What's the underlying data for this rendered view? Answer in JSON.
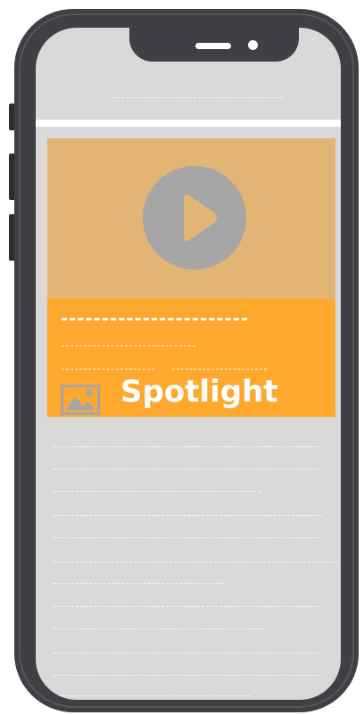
{
  "colors": {
    "phone_body": "#3f3f44",
    "screen_background": "#d9d9d9",
    "video_background": "#e2b574",
    "play_button": "#a6a6a6",
    "card_accent": "#ffa82e",
    "text_placeholder": "#ffffff"
  },
  "card": {
    "video": {
      "icon": "play-icon"
    },
    "thumbnail_icon": "image-icon",
    "label": "Spotlight"
  }
}
